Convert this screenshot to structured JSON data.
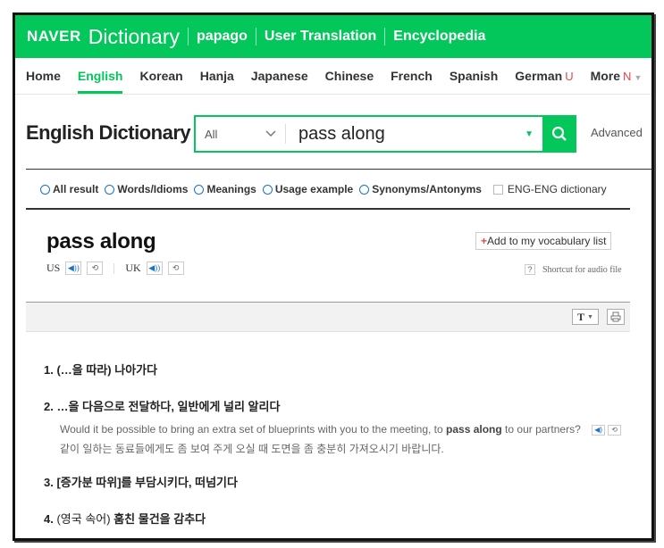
{
  "header": {
    "logo": "NAVER",
    "service": "Dictionary",
    "links": [
      "papago",
      "User Translation",
      "Encyclopedia"
    ],
    "accent_color": "#03c75a"
  },
  "tabs": [
    {
      "label": "Home"
    },
    {
      "label": "English",
      "active": true
    },
    {
      "label": "Korean"
    },
    {
      "label": "Hanja"
    },
    {
      "label": "Japanese"
    },
    {
      "label": "Chinese"
    },
    {
      "label": "French"
    },
    {
      "label": "Spanish"
    },
    {
      "label": "German",
      "badge": "U"
    },
    {
      "label": "More",
      "badge": "N"
    }
  ],
  "search": {
    "dict_title": "English Dictionary",
    "scope": "All",
    "query": "pass along",
    "advanced_label": "Advanced"
  },
  "filters": {
    "options": [
      "All result",
      "Words/Idioms",
      "Meanings",
      "Usage example",
      "Synonyms/Antonyms"
    ],
    "checkbox_label": "ENG-ENG dictionary"
  },
  "entry": {
    "word": "pass along",
    "us_label": "US",
    "uk_label": "UK",
    "add_vocab_label": "Add to my vocabulary list",
    "shortcut_label": "Shortcut for audio file",
    "font_button": "T"
  },
  "meanings": [
    {
      "num": "1.",
      "text": "(…을 따라) 나아가다"
    },
    {
      "num": "2.",
      "text": "…을 다음으로 전달하다, 일반에게 널리 알리다",
      "example_pre": "Would it be possible to bring an extra set of blueprints with you to the meeting, to ",
      "example_bold": "pass along",
      "example_post": " to our partners?",
      "translation": "같이 일하는 동료들에게도 좀 보여 주게 오실 때 도면을 좀 충분히 가져오시기 바랍니다."
    },
    {
      "num": "3.",
      "text": "[증가분 따위]를 부담시키다, 떠넘기다"
    },
    {
      "num": "4.",
      "category": "(영국 속어)",
      "text": " 훔친 물건을 감추다"
    }
  ]
}
